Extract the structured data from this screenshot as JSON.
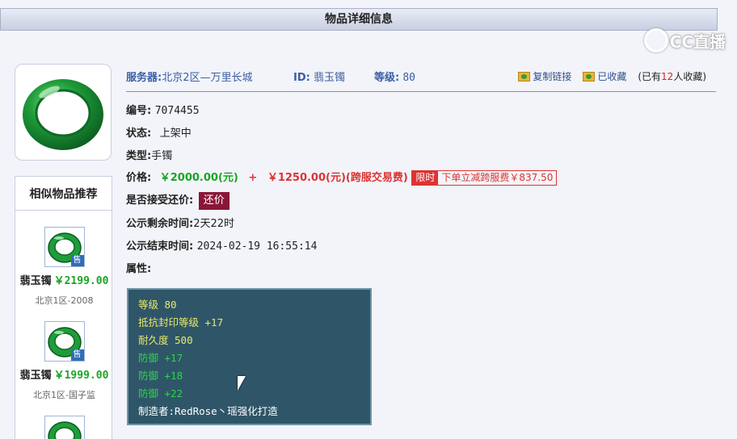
{
  "header": {
    "title": "物品详细信息"
  },
  "watermark": {
    "text": "CC直播"
  },
  "item": {
    "server_label": "服务器:",
    "server_value": "北京2区—万里长城",
    "id_label": "ID:",
    "id_value": "翡玉镯",
    "level_label": "等级:",
    "level_value": "80",
    "actions": {
      "copy_link": "复制链接",
      "favorited": "已收藏",
      "fav_prefix": "(已有",
      "fav_count": "12",
      "fav_suffix": "人收藏)"
    },
    "number_label": "编号:",
    "number_value": "7074455",
    "status_label": "状态:",
    "status_value": "上架中",
    "type_label": "类型:",
    "type_value": "手镯",
    "price_label": "价格:",
    "price_value": "￥2000.00(元)",
    "price_plus": "+",
    "fee_value": "￥1250.00(元)(跨服交易费)",
    "limit_tag": "限时",
    "limit_text": "下单立减跨服费￥837.50",
    "bargain_label": "是否接受还价:",
    "bargain_button": "还价",
    "remain_label": "公示剩余时间:",
    "remain_value": "2天22时",
    "end_label": "公示结束时间:",
    "end_value": "2024-02-19 16:55:14",
    "attr_label": "属性:"
  },
  "attributes": [
    {
      "text": "等级 80",
      "color": "#e9e86a"
    },
    {
      "text": "抵抗封印等级 +17",
      "color": "#e9e86a"
    },
    {
      "text": "耐久度 500",
      "color": "#e9e86a"
    },
    {
      "text": "防御 +17",
      "color": "#2bd64a"
    },
    {
      "text": "防御 +18",
      "color": "#2bd64a"
    },
    {
      "text": "防御 +22",
      "color": "#2bd64a"
    },
    {
      "text": "制造者:RedRose丶瑶强化打造",
      "color": "#ffffff"
    }
  ],
  "sidebar": {
    "title": "相似物品推荐",
    "items": [
      {
        "name": "翡玉镯",
        "price": "￥2199.00",
        "server": "北京1区-2008",
        "badge": "售"
      },
      {
        "name": "翡玉镯",
        "price": "￥1999.00",
        "server": "北京1区-国子监",
        "badge": "售"
      }
    ]
  }
}
